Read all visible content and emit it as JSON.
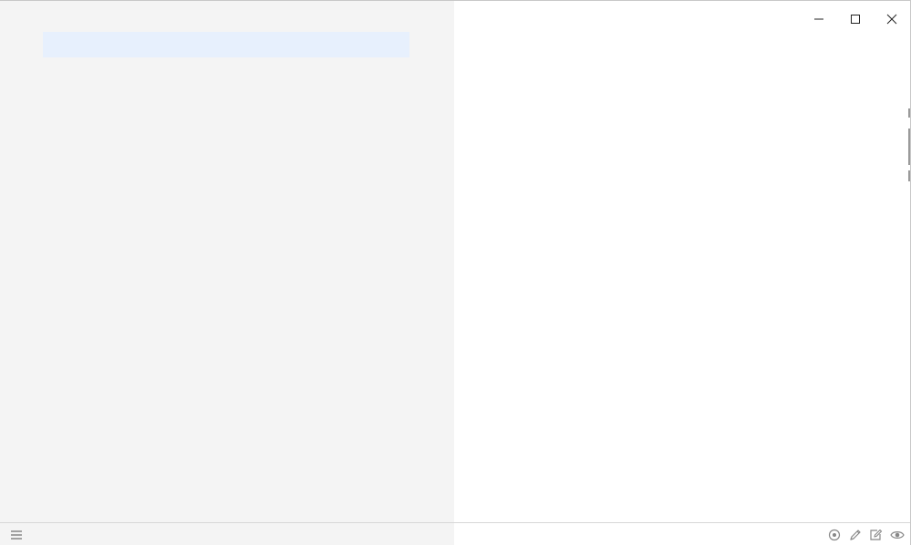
{
  "window": {
    "controls": {
      "minimize_icon": "minimize-icon",
      "maximize_icon": "maximize-icon",
      "close_icon": "close-icon"
    }
  },
  "list": {
    "selected_row_color": "#e7f0fd",
    "pane_color": "#f4f4f4"
  },
  "statusbar": {
    "menu_icon": "hamburger-menu-icon",
    "right_icons": [
      "target-icon",
      "pencil-icon",
      "edit-note-icon",
      "eye-icon"
    ]
  }
}
